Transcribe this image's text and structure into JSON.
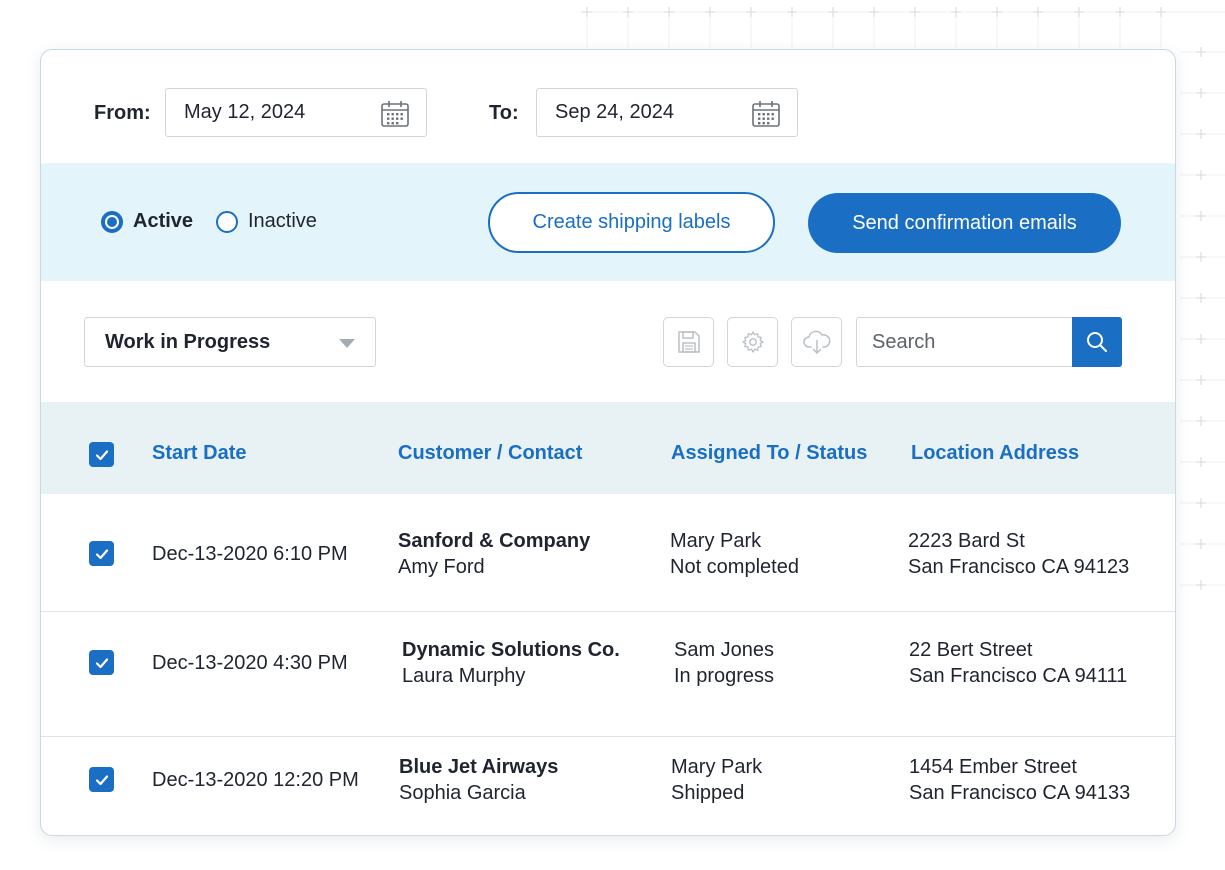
{
  "filters": {
    "from_label": "From:",
    "from_value": "May 12, 2024",
    "to_label": "To:",
    "to_value": "Sep 24, 2024"
  },
  "status_filter": {
    "options": [
      {
        "label": "Active",
        "selected": true
      },
      {
        "label": "Inactive",
        "selected": false
      }
    ]
  },
  "actions": {
    "create_labels": "Create shipping labels",
    "send_emails": "Send confirmation emails"
  },
  "toolbar": {
    "view_select": "Work in Progress",
    "icons": [
      "save-icon",
      "settings-gear-icon",
      "cloud-download-icon"
    ],
    "search_placeholder": "Search"
  },
  "table": {
    "columns": [
      "Start Date",
      "Customer / Contact",
      "Assigned To / Status",
      "Location Address"
    ],
    "rows": [
      {
        "checked": true,
        "start_date": "Dec-13-2020 6:10 PM",
        "customer": "Sanford & Company",
        "contact": "Amy Ford",
        "assigned": "Mary Park",
        "status": "Not completed",
        "address1": "2223 Bard St",
        "address2": "San Francisco CA 94123"
      },
      {
        "checked": true,
        "start_date": "Dec-13-2020 4:30 PM",
        "customer": "Dynamic Solutions Co.",
        "contact": "Laura Murphy",
        "assigned": "Sam Jones",
        "status": "In progress",
        "address1": "22 Bert Street",
        "address2": "San Francisco CA 94111"
      },
      {
        "checked": true,
        "start_date": "Dec-13-2020 12:20 PM",
        "customer": "Blue Jet Airways",
        "contact": "Sophia Garcia",
        "assigned": "Mary Park",
        "status": "Shipped",
        "address1": "1454 Ember Street",
        "address2": "San Francisco CA 94133"
      }
    ]
  },
  "colors": {
    "accent": "#1a6fc4",
    "band": "#e3f4fa",
    "table_header": "#e8f2f4"
  }
}
